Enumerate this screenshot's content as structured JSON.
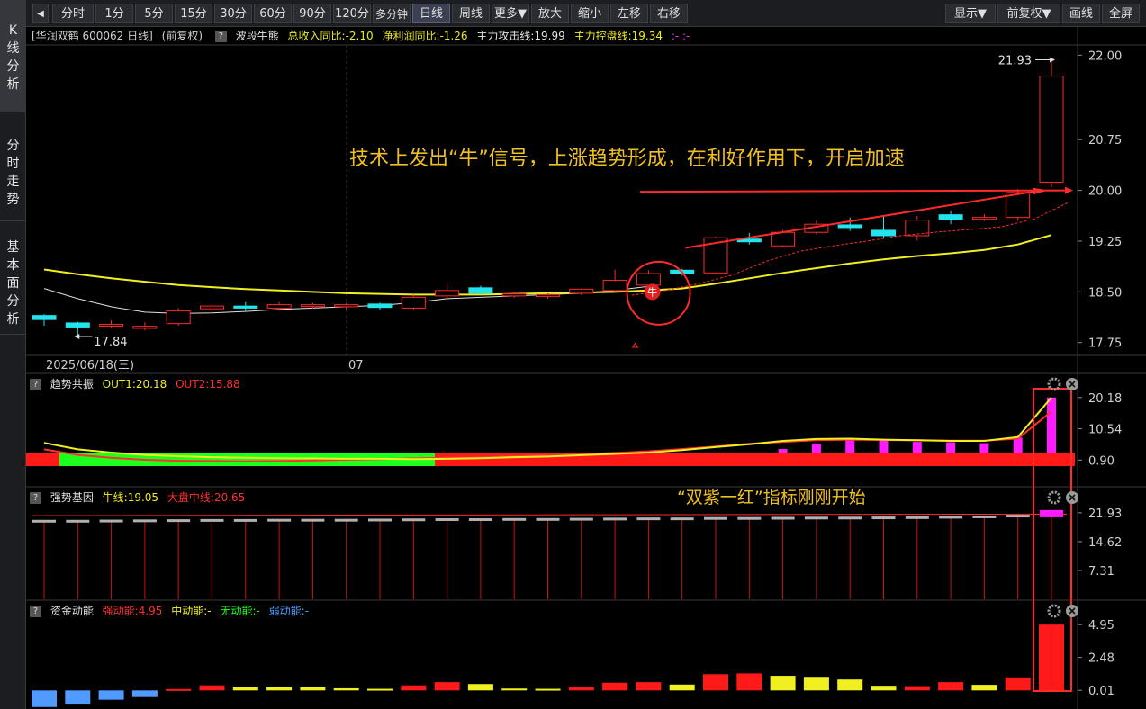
{
  "toolbar": {
    "back_label": "◀",
    "periods": [
      {
        "label": "分时",
        "active": false
      },
      {
        "label": "1分",
        "active": false
      },
      {
        "label": "5分",
        "active": false
      },
      {
        "label": "15分",
        "active": false
      },
      {
        "label": "30分",
        "active": false
      },
      {
        "label": "60分",
        "active": false
      },
      {
        "label": "90分",
        "active": false
      },
      {
        "label": "120分",
        "active": false
      },
      {
        "label": "多分钟",
        "active": false
      },
      {
        "label": "日线",
        "active": true
      },
      {
        "label": "周线",
        "active": false
      },
      {
        "label": "更多▼",
        "active": false
      }
    ],
    "zoom_in": "放大",
    "zoom_out": "缩小",
    "move_left": "左移",
    "move_right": "右移",
    "display": "显示▼",
    "adjust": "前复权▼",
    "draw": "画线",
    "fullscreen": "全屏"
  },
  "left_nav": [
    {
      "label": "K线分析",
      "active": true
    },
    {
      "label": "分时走势",
      "active": false
    },
    {
      "label": "基本面分析",
      "active": false
    }
  ],
  "main_header": {
    "stock": "[华润双鹤 600062 日线]",
    "adjust": "(前复权)",
    "help": "?",
    "indicator": "波段牛熊",
    "income": "总收入同比:-2.10",
    "profit": "净利润同比:-1.26",
    "attack": "主力攻击线:19.99",
    "control": "主力控盘线:19.34",
    "extra": ":-  :-"
  },
  "annotations": {
    "main_text": "技术上发出“牛”信号，上涨趋势形成，在利好作用下，开启加速",
    "sub_text": "“双紫一红”指标刚刚开始",
    "bull_marker": "牛"
  },
  "date_axis": {
    "start": "2025/06/18(三)",
    "month": "07"
  },
  "panels": {
    "trend": {
      "name": "趋势共振",
      "out1": "OUT1:20.18",
      "out2": "OUT2:15.88"
    },
    "strong": {
      "name": "强势基因",
      "niu": "牛线:19.05",
      "dapan": "大盘中线:20.65"
    },
    "fund": {
      "name": "资金动能",
      "strong": "强动能:4.95",
      "mid": "中动能:-",
      "none": "无动能:-",
      "weak": "弱动能:-"
    }
  },
  "colors": {
    "up": "#ff2a2a",
    "down": "#22e4ee",
    "yellow": "#f0f020",
    "white": "#e8e8e8",
    "magenta": "#ff1aff",
    "green": "#1dff1d",
    "blue": "#4f9bff"
  },
  "chart_data": [
    {
      "type": "candlestick",
      "price_ticks": [
        "22.00",
        "20.75",
        "20.00",
        "19.25",
        "18.50",
        "17.75"
      ],
      "ylim": [
        17.6,
        22.15
      ],
      "high_label": "21.93",
      "low_label": "17.84",
      "candles": [
        {
          "o": 18.15,
          "c": 18.09,
          "h": 18.17,
          "l": 18.0
        },
        {
          "o": 18.04,
          "c": 17.98,
          "h": 18.06,
          "l": 17.84
        },
        {
          "o": 18.0,
          "c": 18.02,
          "h": 18.08,
          "l": 17.96
        },
        {
          "o": 17.96,
          "c": 17.99,
          "h": 18.05,
          "l": 17.93
        },
        {
          "o": 18.03,
          "c": 18.22,
          "h": 18.26,
          "l": 18.0
        },
        {
          "o": 18.25,
          "c": 18.29,
          "h": 18.32,
          "l": 18.21
        },
        {
          "o": 18.29,
          "c": 18.26,
          "h": 18.35,
          "l": 18.22
        },
        {
          "o": 18.26,
          "c": 18.31,
          "h": 18.35,
          "l": 18.22
        },
        {
          "o": 18.29,
          "c": 18.31,
          "h": 18.34,
          "l": 18.25
        },
        {
          "o": 18.28,
          "c": 18.31,
          "h": 18.34,
          "l": 18.24
        },
        {
          "o": 18.32,
          "c": 18.27,
          "h": 18.34,
          "l": 18.24
        },
        {
          "o": 18.26,
          "c": 18.42,
          "h": 18.46,
          "l": 18.24
        },
        {
          "o": 18.44,
          "c": 18.52,
          "h": 18.62,
          "l": 18.4
        },
        {
          "o": 18.56,
          "c": 18.48,
          "h": 18.59,
          "l": 18.46
        },
        {
          "o": 18.44,
          "c": 18.47,
          "h": 18.5,
          "l": 18.41
        },
        {
          "o": 18.45,
          "c": 18.46,
          "h": 18.48,
          "l": 18.4
        },
        {
          "o": 18.48,
          "c": 18.54,
          "h": 18.55,
          "l": 18.45
        },
        {
          "o": 18.52,
          "c": 18.67,
          "h": 18.83,
          "l": 18.5
        },
        {
          "o": 18.6,
          "c": 18.77,
          "h": 18.82,
          "l": 18.55
        },
        {
          "o": 18.82,
          "c": 18.77,
          "h": 18.84,
          "l": 18.74
        },
        {
          "o": 18.78,
          "c": 19.3,
          "h": 19.32,
          "l": 18.76
        },
        {
          "o": 19.28,
          "c": 19.24,
          "h": 19.37,
          "l": 19.2
        },
        {
          "o": 19.18,
          "c": 19.38,
          "h": 19.42,
          "l": 19.16
        },
        {
          "o": 19.38,
          "c": 19.5,
          "h": 19.56,
          "l": 19.35
        },
        {
          "o": 19.49,
          "c": 19.45,
          "h": 19.6,
          "l": 19.4
        },
        {
          "o": 19.41,
          "c": 19.33,
          "h": 19.62,
          "l": 19.3
        },
        {
          "o": 19.33,
          "c": 19.56,
          "h": 19.62,
          "l": 19.26
        },
        {
          "o": 19.64,
          "c": 19.57,
          "h": 19.7,
          "l": 19.5
        },
        {
          "o": 19.6,
          "c": 19.6,
          "h": 19.65,
          "l": 19.55
        },
        {
          "o": 19.6,
          "c": 19.97,
          "h": 20.02,
          "l": 19.55
        },
        {
          "o": 20.12,
          "c": 21.69,
          "h": 21.93,
          "l": 20.05
        }
      ],
      "yellow_line": [
        18.83,
        18.76,
        18.7,
        18.65,
        18.6,
        18.57,
        18.54,
        18.52,
        18.5,
        18.48,
        18.47,
        18.46,
        18.46,
        18.46,
        18.47,
        18.48,
        18.49,
        18.5,
        18.52,
        18.55,
        18.62,
        18.7,
        18.78,
        18.85,
        18.92,
        18.98,
        19.03,
        19.07,
        19.12,
        19.2,
        19.34
      ],
      "white_line": [
        18.55,
        18.4,
        18.28,
        18.2,
        18.18,
        18.19,
        18.21,
        18.24,
        18.26,
        18.28,
        18.3,
        18.34,
        18.4,
        18.42,
        18.44,
        18.46,
        18.48,
        18.52,
        18.58
      ]
    },
    {
      "type": "bar",
      "name": "趋势共振",
      "ticks": [
        "20.18",
        "10.54",
        "0.90"
      ],
      "ylim": [
        -1.5,
        21.5
      ],
      "magenta_bars": [
        0,
        0,
        0,
        0,
        0,
        0,
        0,
        0,
        0,
        0,
        0,
        0,
        0,
        0,
        0,
        0,
        0,
        0,
        0.5,
        0.9,
        1.4,
        2.2,
        4.3,
        6.0,
        7.2,
        7.1,
        6.5,
        6.4,
        6.1,
        7.8,
        20.18
      ],
      "out1": [
        6.2,
        4.2,
        3.2,
        2.5,
        2.1,
        1.8,
        1.6,
        1.5,
        1.4,
        1.3,
        1.3,
        1.2,
        1.3,
        1.5,
        1.8,
        2.0,
        2.4,
        2.8,
        3.2,
        4.0,
        4.9,
        5.8,
        6.8,
        7.4,
        7.5,
        7.2,
        7.0,
        6.8,
        6.8,
        8.0,
        20.18
      ],
      "out2": [
        4.2,
        2.5,
        1.6,
        1.0,
        0.7,
        0.6,
        0.5,
        0.6,
        0.8,
        1.0,
        1.2,
        1.4,
        1.6,
        1.8,
        2.1,
        2.4,
        2.7,
        3.1,
        3.6,
        4.3,
        5.1,
        5.9,
        6.5,
        7.0,
        7.2,
        7.1,
        7.0,
        6.9,
        6.9,
        7.5,
        15.88
      ]
    },
    {
      "type": "bar",
      "name": "强势基因",
      "ticks": [
        "21.93",
        "14.62",
        "7.31"
      ],
      "ylim": [
        0,
        23.5
      ]
    },
    {
      "type": "bar",
      "name": "资金动能",
      "ticks": [
        "4.95",
        "2.48",
        "0.01"
      ],
      "ylim": [
        -1.4,
        5.3
      ],
      "values": [
        -1.25,
        -1.0,
        -0.7,
        -0.5,
        0.1,
        0.38,
        0.26,
        0.24,
        0.24,
        0.16,
        0.12,
        0.38,
        0.62,
        0.48,
        0.14,
        0.12,
        0.26,
        0.58,
        0.62,
        0.44,
        1.22,
        1.28,
        1.1,
        1.02,
        0.82,
        0.35,
        0.32,
        0.62,
        0.42,
        0.98,
        4.95
      ],
      "bar_colors": [
        "blue",
        "blue",
        "blue",
        "blue",
        "red",
        "red",
        "yellow",
        "yellow",
        "yellow",
        "yellow",
        "yellow",
        "red",
        "red",
        "yellow",
        "yellow",
        "yellow",
        "red",
        "red",
        "red",
        "yellow",
        "red",
        "red",
        "yellow",
        "yellow",
        "yellow",
        "yellow",
        "red",
        "red",
        "yellow",
        "red",
        "red"
      ]
    }
  ]
}
